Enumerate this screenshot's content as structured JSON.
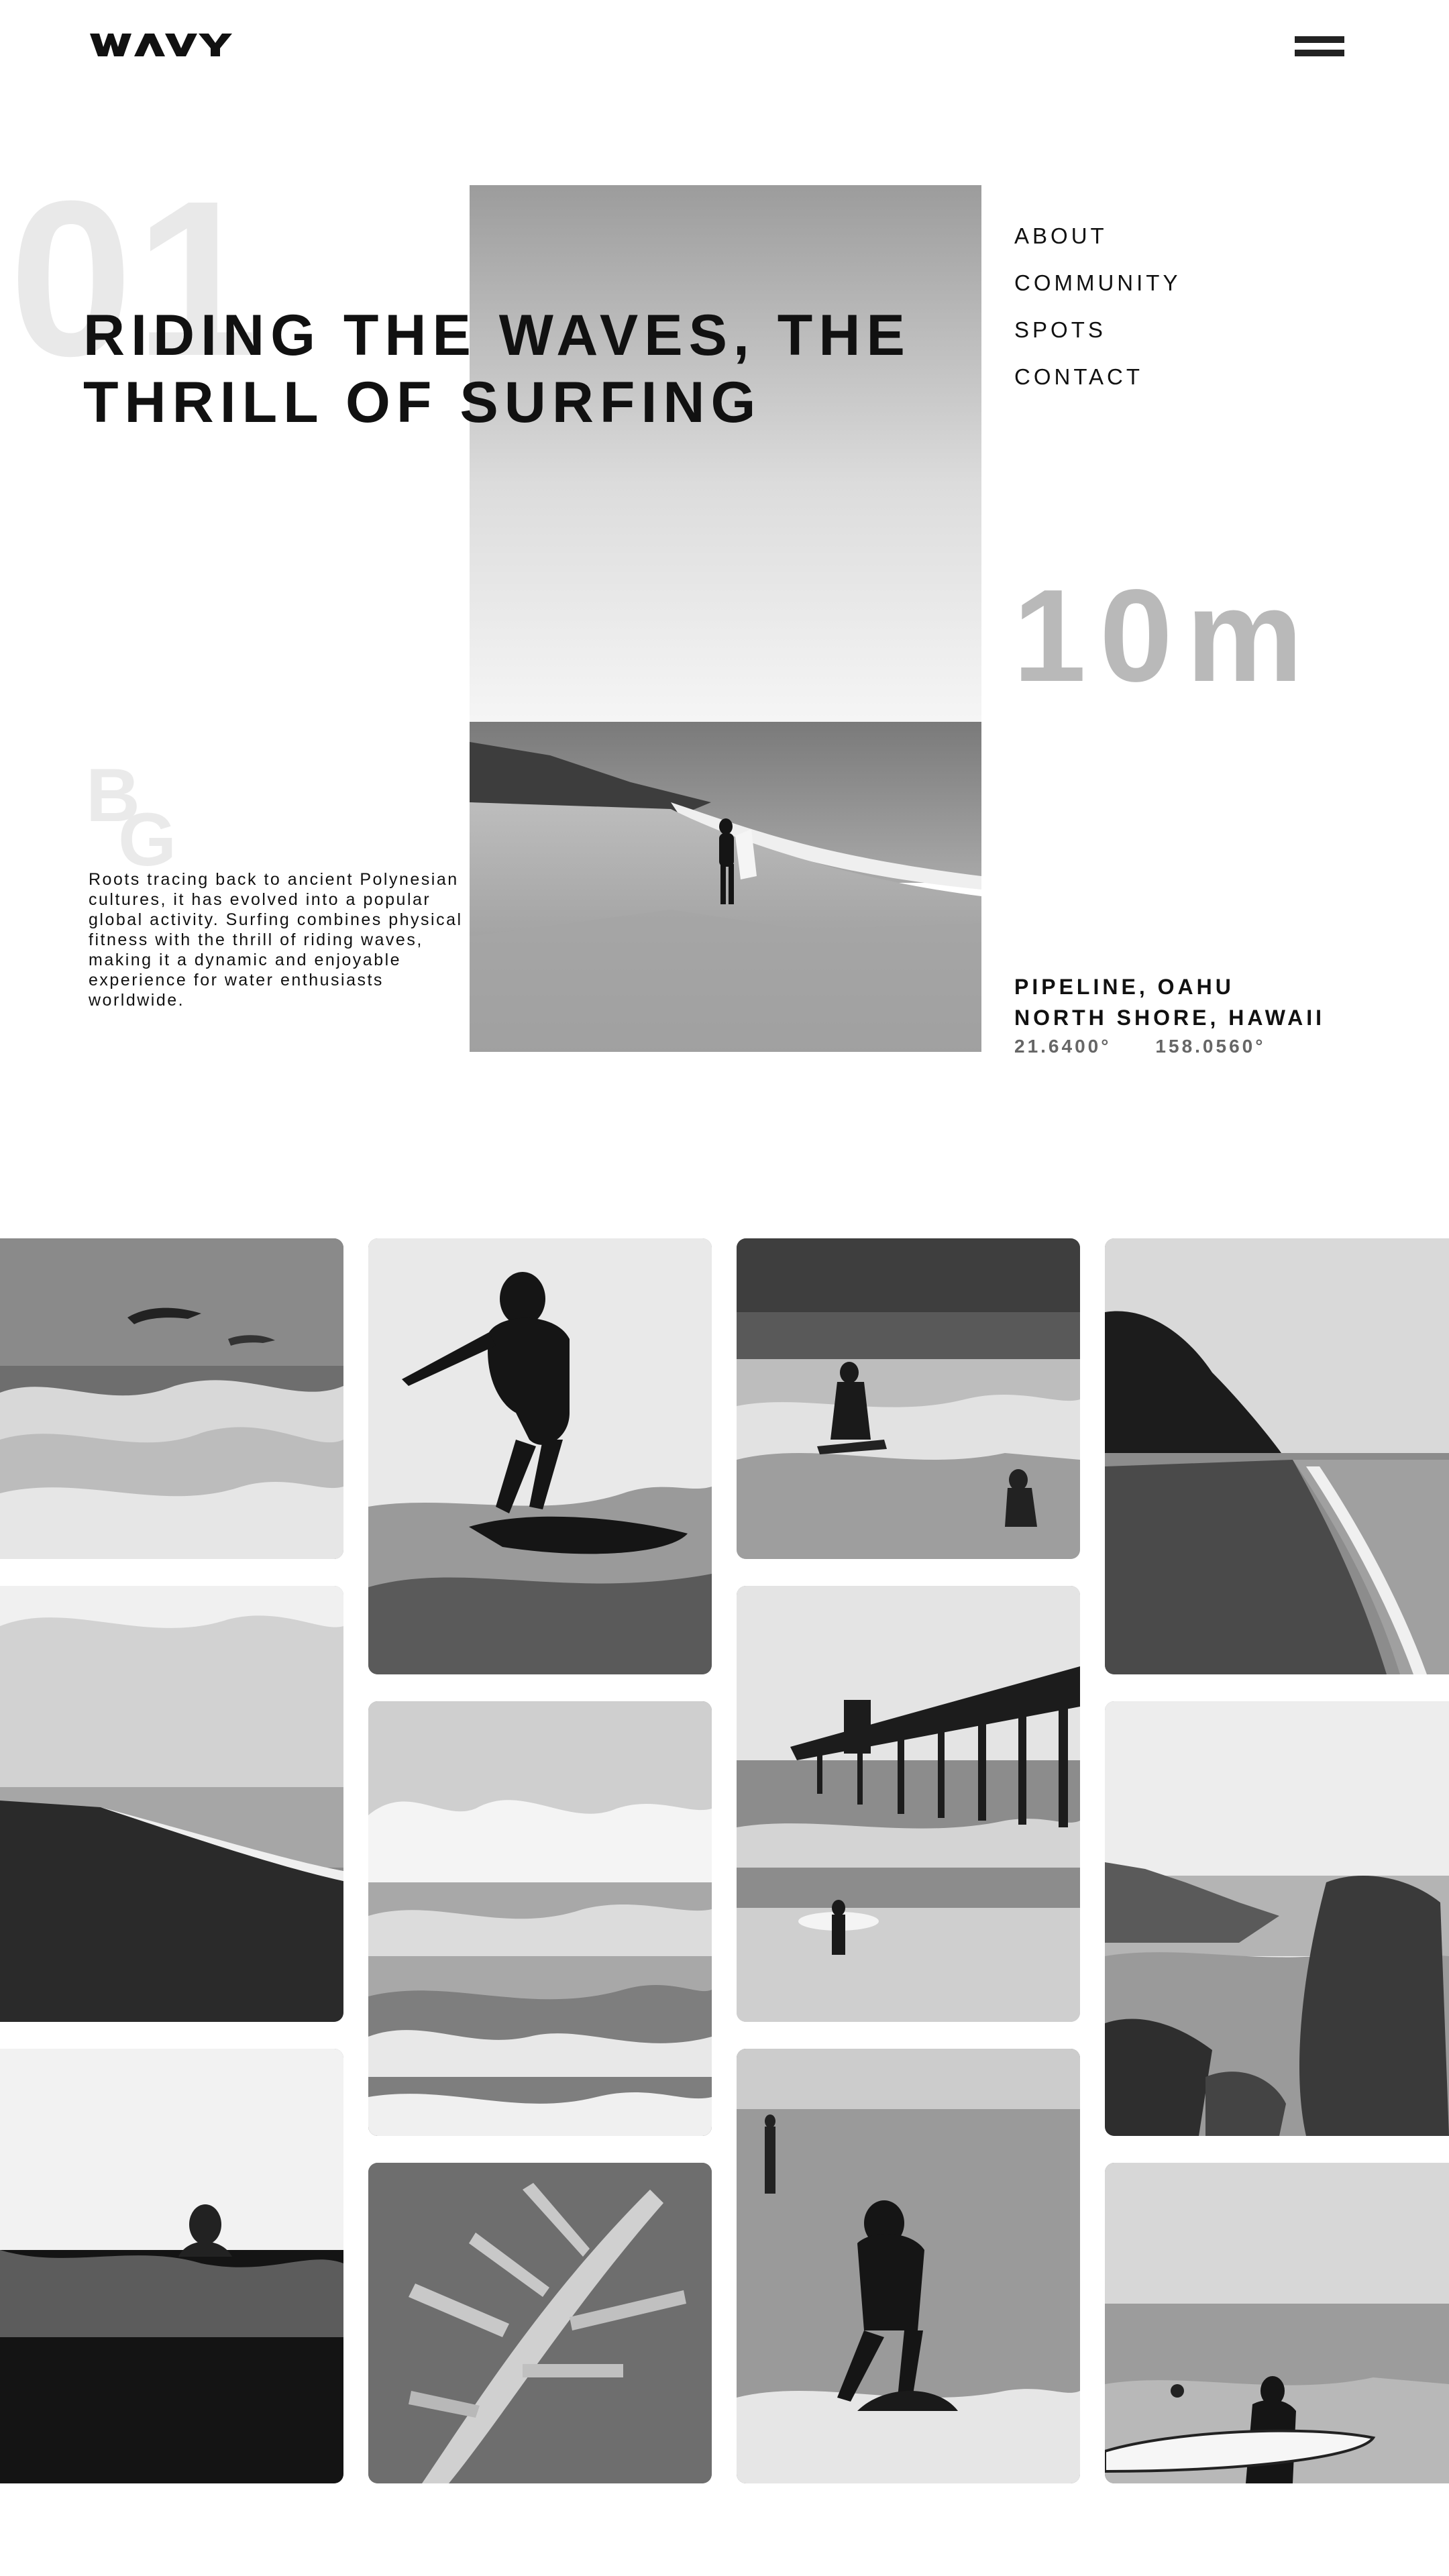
{
  "header": {
    "logo_text": "WAVY",
    "menu_icon": "hamburger-icon"
  },
  "hero": {
    "index": "01",
    "title_line1": "RIDING THE WAVES, THE",
    "title_line2": "THRILL OF SURFING",
    "bg_letter1": "B",
    "bg_letter2": "G",
    "description": "Roots tracing back to ancient Polynesian cultures, it has evolved into a popular global activity. Surfing combines physical fitness with the thrill of riding waves, making it a dynamic and enjoyable experience for water enthusiasts worldwide."
  },
  "nav": {
    "items": [
      "ABOUT",
      "COMMUNITY",
      "SPOTS",
      "CONTACT"
    ]
  },
  "stats": {
    "depth": "10m"
  },
  "location": {
    "line1": "PIPELINE, OAHU",
    "line2": "NORTH SHORE, HAWAII",
    "lat": "21.6400°",
    "lon": "158.0560°"
  },
  "colors": {
    "text": "#111111",
    "ghost": "#e9e9e9",
    "depth": "#b9b9b9",
    "coords": "#666666"
  }
}
